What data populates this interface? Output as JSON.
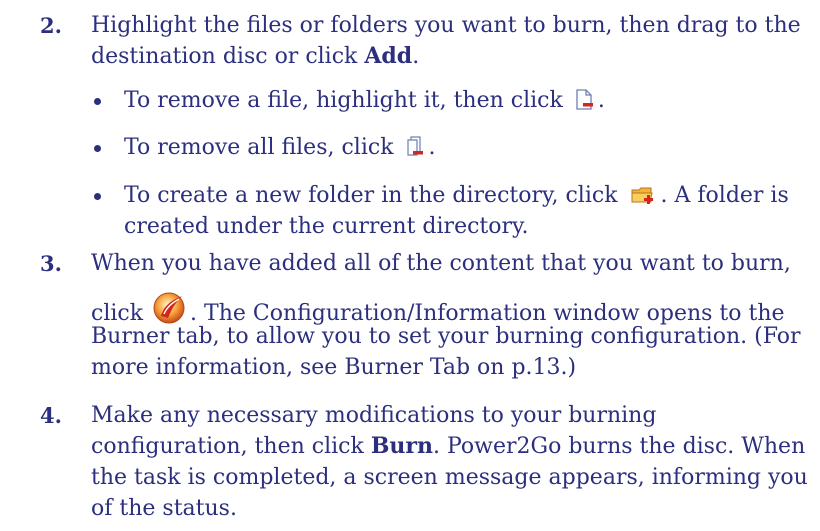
{
  "step2": {
    "number": "2.",
    "text_a": "Highlight the files or folders you want to burn, then drag to the",
    "text_b": "destination disc or click ",
    "bold": "Add",
    "text_c": ".",
    "bullets": [
      {
        "text": "To remove a file, highlight it, then click",
        "after": ".",
        "icon": "remove-file-icon"
      },
      {
        "text": "To remove all files, click",
        "after": ".",
        "icon": "remove-all-files-icon"
      },
      {
        "text": "To create a new folder in the directory, click",
        "after": ". A folder is",
        "line2": "created under the current directory.",
        "icon": "new-folder-icon"
      }
    ]
  },
  "step3": {
    "number": "3.",
    "line1": "When you have added all of the content that you want to burn,",
    "line2a": "click",
    "line2b": ". The Configuration/Information window opens to the",
    "line3": "Burner tab, to allow you to set your burning configuration. (For",
    "line4": "more information, see Burner Tab on p.13.)",
    "icon": "burn-icon"
  },
  "step4": {
    "number": "4.",
    "line1": "Make any necessary modifications to your burning",
    "line2a": "configuration, then click ",
    "bold": "Burn",
    "line2b": ". Power2Go burns the disc. When",
    "line3": "the task is completed, a screen message appears, informing you",
    "line4": "of the status."
  },
  "colors": {
    "text": "#2b2f7d",
    "icon_red": "#d0281e",
    "icon_orange": "#e8821e"
  }
}
